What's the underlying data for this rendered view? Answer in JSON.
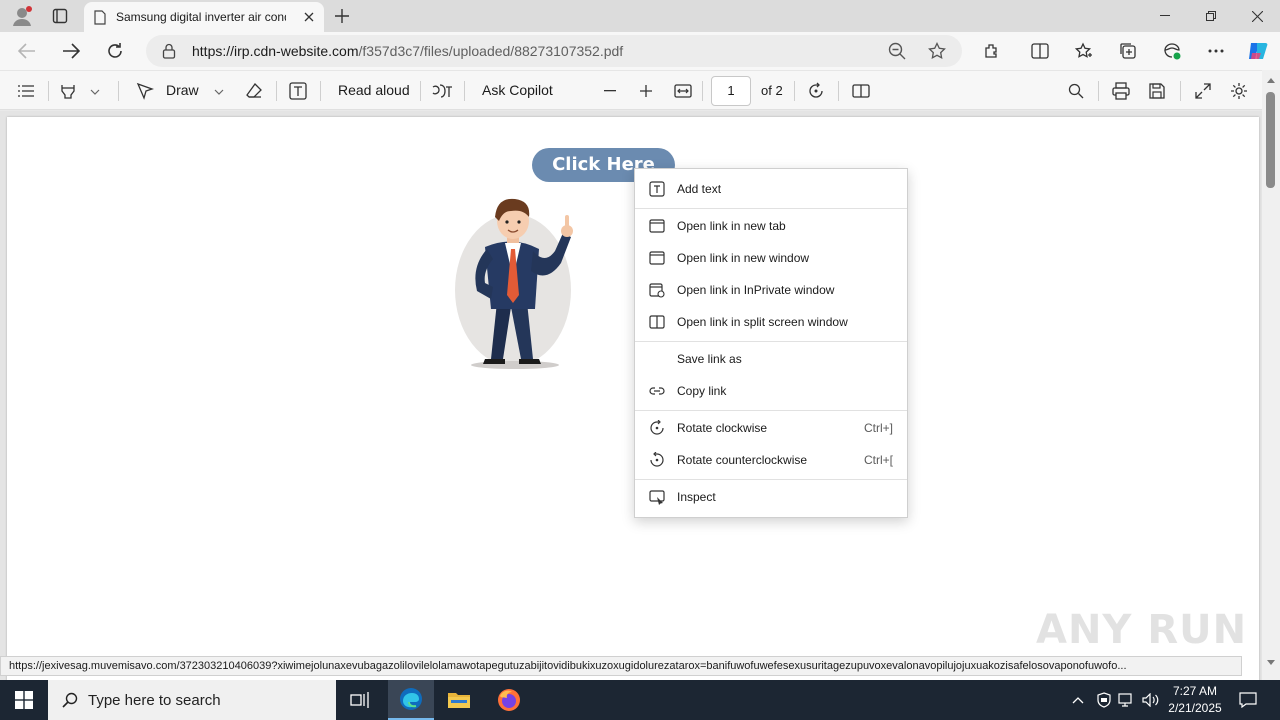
{
  "browser": {
    "tab_title": "Samsung digital inverter air cond",
    "url_host": "https://irp.cdn-website.com",
    "url_path": "/f357d3c7/files/uploaded/88273107352.pdf"
  },
  "pdf_toolbar": {
    "draw_label": "Draw",
    "read_aloud_label": "Read aloud",
    "ask_copilot_label": "Ask Copilot",
    "page_current": "1",
    "page_total": "of 2"
  },
  "document": {
    "button_label": "Click Here"
  },
  "context_menu": {
    "items": [
      {
        "label": "Add text",
        "shortcut": ""
      },
      {
        "label": "Open link in new tab",
        "shortcut": ""
      },
      {
        "label": "Open link in new window",
        "shortcut": ""
      },
      {
        "label": "Open link in InPrivate window",
        "shortcut": ""
      },
      {
        "label": "Open link in split screen window",
        "shortcut": ""
      },
      {
        "label": "Save link as",
        "shortcut": ""
      },
      {
        "label": "Copy link",
        "shortcut": ""
      },
      {
        "label": "Rotate clockwise",
        "shortcut": "Ctrl+]"
      },
      {
        "label": "Rotate counterclockwise",
        "shortcut": "Ctrl+["
      },
      {
        "label": "Inspect",
        "shortcut": ""
      }
    ]
  },
  "status_url": "https://jexivesag.muvemisavo.com/372303210406039?xiwimejolunaxevubagazolilovilelolamawotapegutuzabijitovidibukixuzoxugidolurezatarox=banifuwofuwefesexusuritagezupuvoxevalonavopilujojuxuakozisafelosovaponofuwofo...",
  "taskbar": {
    "search_placeholder": "Type here to search",
    "time": "7:27 AM",
    "date": "2/21/2025"
  },
  "watermark": "ANY RUN",
  "colors": {
    "button_bg": "#6b8bb0",
    "taskbar_bg": "#1c2633",
    "edge_accent": "#0f6cbd"
  }
}
